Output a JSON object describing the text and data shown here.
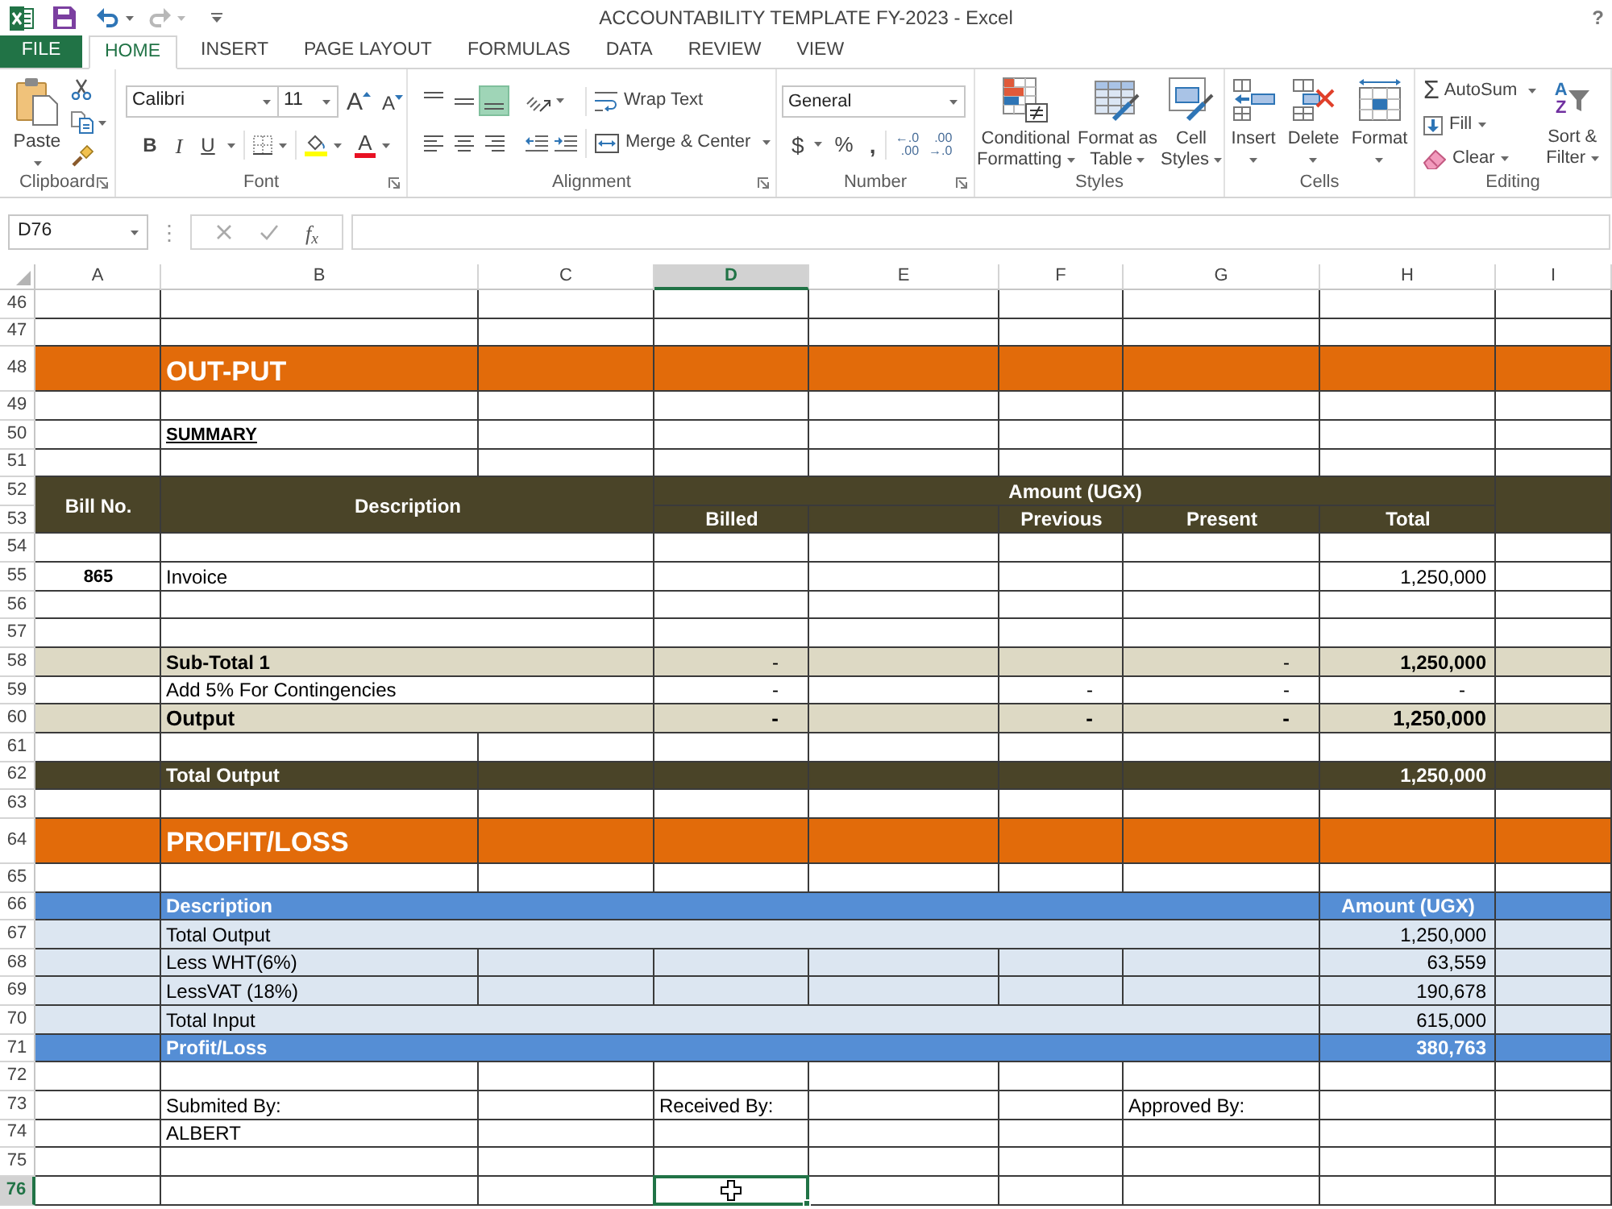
{
  "window": {
    "title": "ACCOUNTABILITY TEMPLATE FY-2023 - Excel",
    "help": "?"
  },
  "quick_access": [
    {
      "kind": "save",
      "disabled": false
    },
    {
      "kind": "undo",
      "disabled": false
    },
    {
      "kind": "redo",
      "disabled": true
    }
  ],
  "file_tab": {
    "label": "FILE"
  },
  "tabs": [
    {
      "label": "HOME",
      "selected": true
    },
    {
      "label": "INSERT",
      "selected": false
    },
    {
      "label": "PAGE LAYOUT",
      "selected": false
    },
    {
      "label": "FORMULAS",
      "selected": false
    },
    {
      "label": "DATA",
      "selected": false
    },
    {
      "label": "REVIEW",
      "selected": false
    },
    {
      "label": "VIEW",
      "selected": false
    }
  ],
  "ribbon": {
    "clipboard": {
      "title": "Clipboard",
      "paste": "Paste"
    },
    "font": {
      "title": "Font",
      "font_name": "Calibri",
      "font_size": "11",
      "grow_font": "A",
      "shrink_font": "A",
      "bold": "B",
      "italic": "I",
      "underline": "U",
      "font_color": "A"
    },
    "alignment": {
      "title": "Alignment",
      "vertical": [
        {
          "kind": "top",
          "selected": false
        },
        {
          "kind": "middle",
          "selected": false
        },
        {
          "kind": "bottom",
          "selected": true
        }
      ],
      "horizontal": [
        {
          "kind": "left",
          "selected": false
        },
        {
          "kind": "center",
          "selected": false
        },
        {
          "kind": "right",
          "selected": false
        }
      ],
      "wrap_text": "Wrap Text",
      "merge_center": "Merge & Center"
    },
    "number": {
      "title": "Number",
      "format": "General",
      "currency": "$",
      "percent": "%",
      "comma": ",",
      "increase_decimal": [
        "←.0",
        ".00"
      ],
      "decrease_decimal": [
        ".00",
        "→.0"
      ]
    },
    "styles": {
      "title": "Styles",
      "buttons": [
        {
          "kind": "conditional_formatting",
          "lines": [
            "Conditional",
            "Formatting"
          ]
        },
        {
          "kind": "format_as_table",
          "lines": [
            "Format as",
            "Table"
          ]
        },
        {
          "kind": "cell_styles",
          "lines": [
            "Cell",
            "Styles"
          ]
        }
      ]
    },
    "cells": {
      "title": "Cells",
      "buttons": [
        {
          "kind": "insert",
          "label": "Insert"
        },
        {
          "kind": "delete",
          "label": "Delete"
        },
        {
          "kind": "format",
          "label": "Format"
        }
      ]
    },
    "editing": {
      "title": "Editing",
      "autosum_symbol": "Σ",
      "autosum": "AutoSum",
      "fill": "Fill",
      "clear": "Clear",
      "sort_letters": [
        "A",
        "Z"
      ],
      "sort_filter": [
        "Sort &",
        "Filter"
      ]
    }
  },
  "formula_bar": {
    "name_box": "D76",
    "grip": "⋮",
    "function_button": "f$_{x}$"
  },
  "sheet": {
    "columns": [
      {
        "label": "A",
        "selected": false
      },
      {
        "label": "B",
        "selected": false
      },
      {
        "label": "C",
        "selected": false
      },
      {
        "label": "D",
        "selected": true
      },
      {
        "label": "E",
        "selected": false
      },
      {
        "label": "F",
        "selected": false
      },
      {
        "label": "G",
        "selected": false
      },
      {
        "label": "H",
        "selected": false
      },
      {
        "label": "I",
        "selected": false
      }
    ],
    "rows": [
      {
        "number": "46",
        "kind": "blank",
        "selected": false
      },
      {
        "number": "47",
        "kind": "blank",
        "selected": false
      },
      {
        "number": "48",
        "kind": "section",
        "selected": false,
        "title": "OUT-PUT"
      },
      {
        "number": "49",
        "kind": "blank",
        "selected": false
      },
      {
        "number": "50",
        "kind": "caption",
        "selected": false,
        "text": "SUMMARY"
      },
      {
        "number": "51",
        "kind": "blank",
        "selected": false
      },
      {
        "number": "52",
        "kind": "header",
        "selected": false,
        "bill_no": "Bill No.",
        "description": "Description",
        "amount_group": "Amount (UGX)"
      },
      {
        "number": "53",
        "kind": "subheader",
        "selected": false,
        "billed": "Billed",
        "previous": "Previous",
        "present": "Present",
        "total": "Total"
      },
      {
        "number": "54",
        "kind": "entry",
        "selected": false
      },
      {
        "number": "55",
        "kind": "entry",
        "selected": false,
        "bill_no": "865",
        "description": "Invoice",
        "total": {
          "text": "1,250,000",
          "kind": "value"
        }
      },
      {
        "number": "56",
        "kind": "entry",
        "selected": false
      },
      {
        "number": "57",
        "kind": "entry",
        "selected": false
      },
      {
        "number": "58",
        "kind": "subtotal",
        "selected": false,
        "description": "Sub-Total 1",
        "billed": {
          "text": "-",
          "kind": "nil"
        },
        "present": {
          "text": "-",
          "kind": "nil"
        },
        "total": {
          "text": "1,250,000",
          "kind": "value"
        }
      },
      {
        "number": "59",
        "kind": "entry",
        "selected": false,
        "description": "Add 5% For Contingencies",
        "billed": {
          "text": "-",
          "kind": "nil"
        },
        "previous": {
          "text": "-",
          "kind": "nil"
        },
        "present": {
          "text": "-",
          "kind": "nil"
        },
        "total": {
          "text": "-",
          "kind": "nil"
        }
      },
      {
        "number": "60",
        "kind": "output",
        "selected": false,
        "description": "Output",
        "billed": {
          "text": "-",
          "kind": "nil"
        },
        "previous": {
          "text": "-",
          "kind": "nil"
        },
        "present": {
          "text": "-",
          "kind": "nil"
        },
        "total": {
          "text": "1,250,000",
          "kind": "value"
        }
      },
      {
        "number": "61",
        "kind": "blank",
        "selected": false
      },
      {
        "number": "62",
        "kind": "grand_total",
        "selected": false,
        "description": "Total Output",
        "total": {
          "text": "1,250,000",
          "kind": "value"
        }
      },
      {
        "number": "63",
        "kind": "blank",
        "selected": false
      },
      {
        "number": "64",
        "kind": "section",
        "selected": false,
        "title": "PROFIT/LOSS"
      },
      {
        "number": "65",
        "kind": "blank",
        "selected": false
      },
      {
        "number": "66",
        "kind": "pl_header",
        "selected": false,
        "description": "Description",
        "amount": "Amount (UGX)"
      },
      {
        "number": "67",
        "kind": "pl_line",
        "selected": false,
        "description": "Total Output",
        "amount": "1,250,000"
      },
      {
        "number": "68",
        "kind": "pl_item",
        "selected": false,
        "description": "Less WHT(6%)",
        "amount": "63,559"
      },
      {
        "number": "69",
        "kind": "pl_item",
        "selected": false,
        "description": "LessVAT (18%)",
        "amount": "190,678"
      },
      {
        "number": "70",
        "kind": "pl_line",
        "selected": false,
        "description": "Total Input",
        "amount": "615,000"
      },
      {
        "number": "71",
        "kind": "pl_result",
        "selected": false,
        "description": "Profit/Loss",
        "amount": "380,763"
      },
      {
        "number": "72",
        "kind": "blank",
        "selected": false
      },
      {
        "number": "73",
        "kind": "signatures",
        "selected": false,
        "labels": [
          "Submited By:",
          "Received By:",
          "Approved By:"
        ]
      },
      {
        "number": "74",
        "kind": "names",
        "selected": false,
        "name": "ALBERT"
      },
      {
        "number": "75",
        "kind": "blank",
        "selected": false
      },
      {
        "number": "76",
        "kind": "blank",
        "selected": true
      }
    ]
  }
}
